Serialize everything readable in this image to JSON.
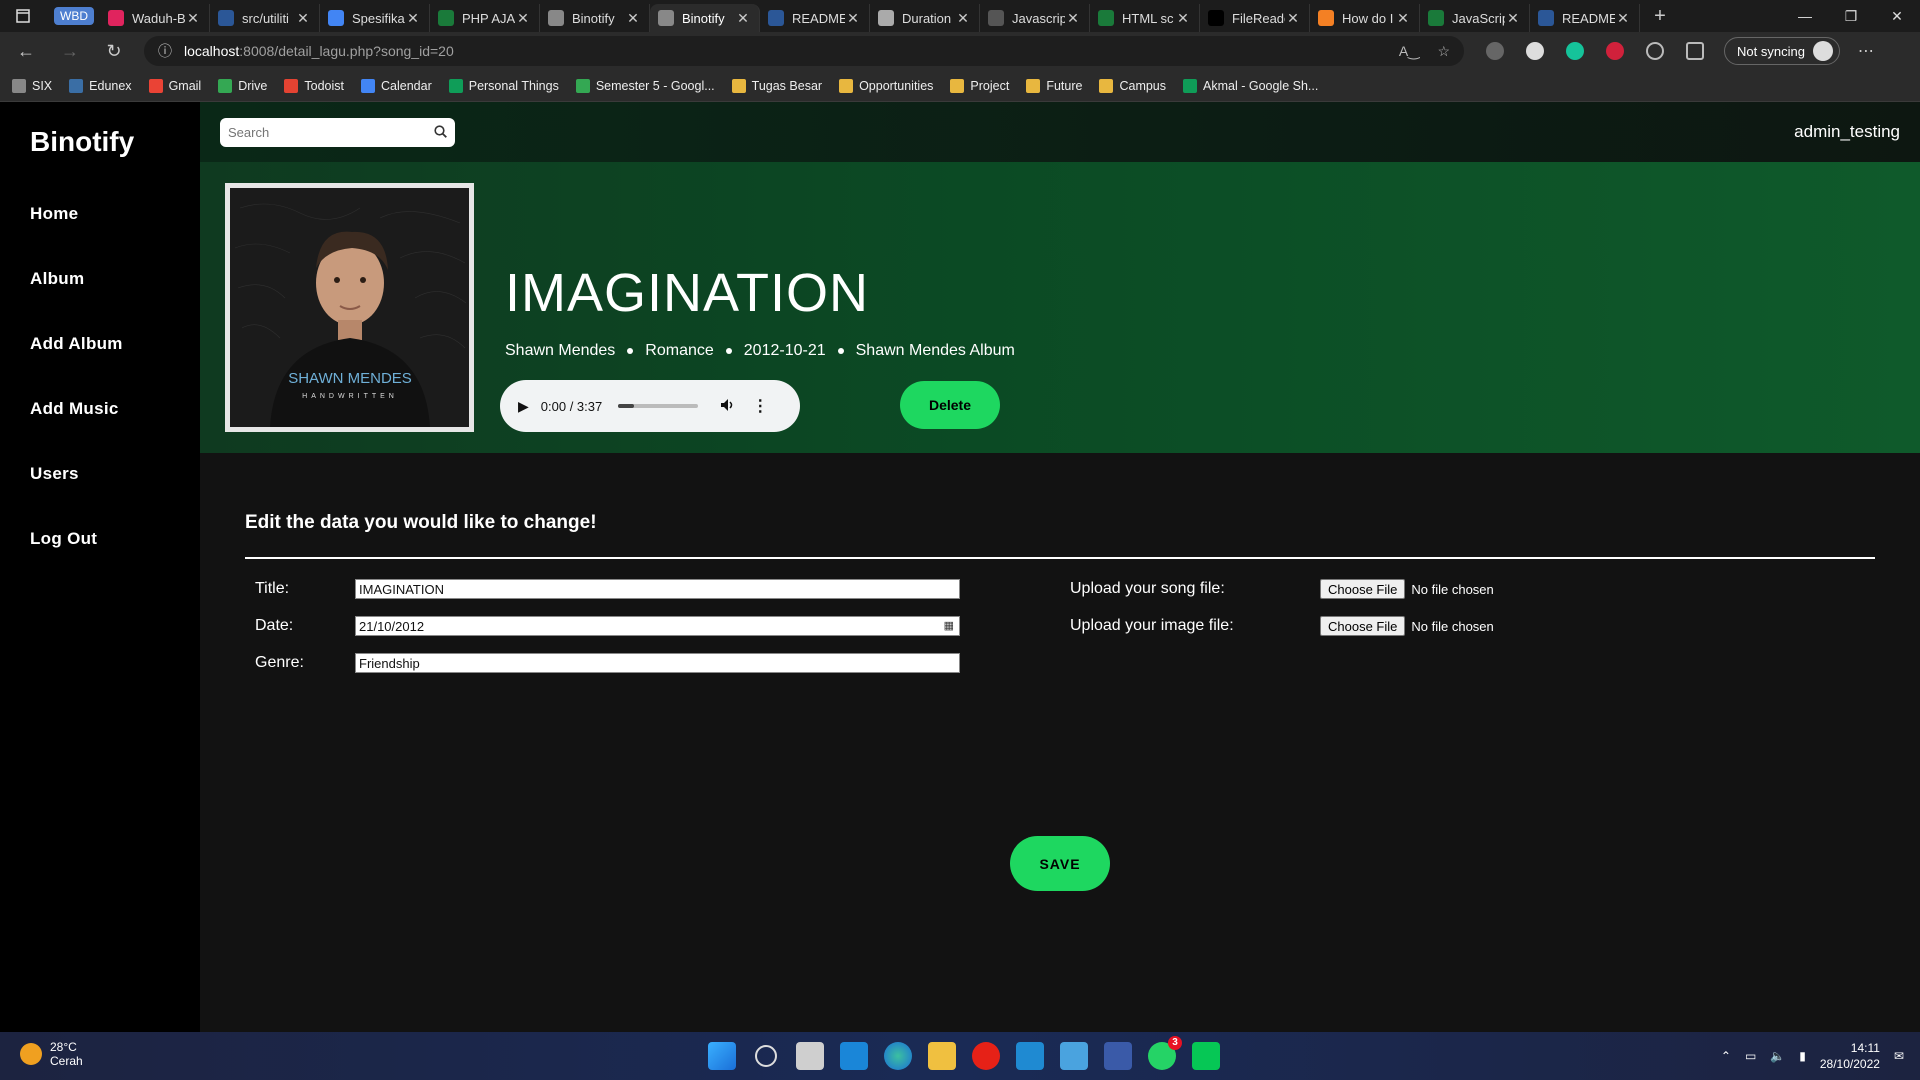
{
  "browser": {
    "workspace_badge": "WBD",
    "tabs": [
      {
        "title": "Waduh-B",
        "color": "#e0245e"
      },
      {
        "title": "src/utiliti",
        "color": "#2b5797"
      },
      {
        "title": "Spesifika",
        "color": "#4285f4"
      },
      {
        "title": "PHP AJA",
        "color": "#1a7a3a"
      },
      {
        "title": "Binotify",
        "color": "#888888"
      },
      {
        "title": "Binotify",
        "color": "#888888"
      },
      {
        "title": "README",
        "color": "#2b5797"
      },
      {
        "title": "Duration",
        "color": "#aaaaaa"
      },
      {
        "title": "Javascrip",
        "color": "#555555"
      },
      {
        "title": "HTML sc",
        "color": "#1a7a3a"
      },
      {
        "title": "FileReadc",
        "color": "#000000"
      },
      {
        "title": "How do I",
        "color": "#f48024"
      },
      {
        "title": "JavaScrip",
        "color": "#1a7a3a"
      },
      {
        "title": "README",
        "color": "#2b5797"
      }
    ],
    "url_host": "localhost",
    "url_path": ":8008/detail_lagu.php?song_id=20",
    "sync_label": "Not syncing",
    "bookmarks": [
      {
        "label": "SIX",
        "color": "#888888"
      },
      {
        "label": "Edunex",
        "color": "#3a6ea5"
      },
      {
        "label": "Gmail",
        "color": "#ea4335"
      },
      {
        "label": "Drive",
        "color": "#34a853"
      },
      {
        "label": "Todoist",
        "color": "#e44332"
      },
      {
        "label": "Calendar",
        "color": "#4285f4"
      },
      {
        "label": "Personal Things",
        "color": "#0f9d58"
      },
      {
        "label": "Semester 5 - Googl...",
        "color": "#34a853"
      },
      {
        "label": "Tugas Besar",
        "color": "#e8b73f"
      },
      {
        "label": "Opportunities",
        "color": "#e8b73f"
      },
      {
        "label": "Project",
        "color": "#e8b73f"
      },
      {
        "label": "Future",
        "color": "#e8b73f"
      },
      {
        "label": "Campus",
        "color": "#e8b73f"
      },
      {
        "label": "Akmal - Google Sh...",
        "color": "#0f9d58"
      }
    ]
  },
  "app": {
    "brand": "Binotify",
    "nav": [
      "Home",
      "Album",
      "Add Album",
      "Add Music",
      "Users",
      "Log Out"
    ],
    "search_placeholder": "Search",
    "username": "admin_testing"
  },
  "song": {
    "title": "IMAGINATION",
    "artist": "Shawn Mendes",
    "genre": "Romance",
    "date": "2012-10-21",
    "album": "Shawn Mendes Album",
    "cover_text_1": "SHAWN MENDES",
    "cover_text_2": "HANDWRITTEN",
    "player_time": "0:00 / 3:37",
    "player_volume_fraction": 0.2,
    "delete_label": "Delete"
  },
  "edit_form": {
    "heading": "Edit the data you would like to change!",
    "title_label": "Title:",
    "title_value": "IMAGINATION",
    "date_label": "Date:",
    "date_value": "21/10/2012",
    "genre_label": "Genre:",
    "genre_value": "Friendship",
    "song_file_label": "Upload your song file:",
    "image_file_label": "Upload your image file:",
    "choose_file": "Choose File",
    "no_file": "No file chosen",
    "save_label": "SAVE"
  },
  "taskbar": {
    "temperature": "28°C",
    "weather": "Cerah",
    "time": "14:11",
    "date": "28/10/2022",
    "whatsapp_badge": "3"
  }
}
